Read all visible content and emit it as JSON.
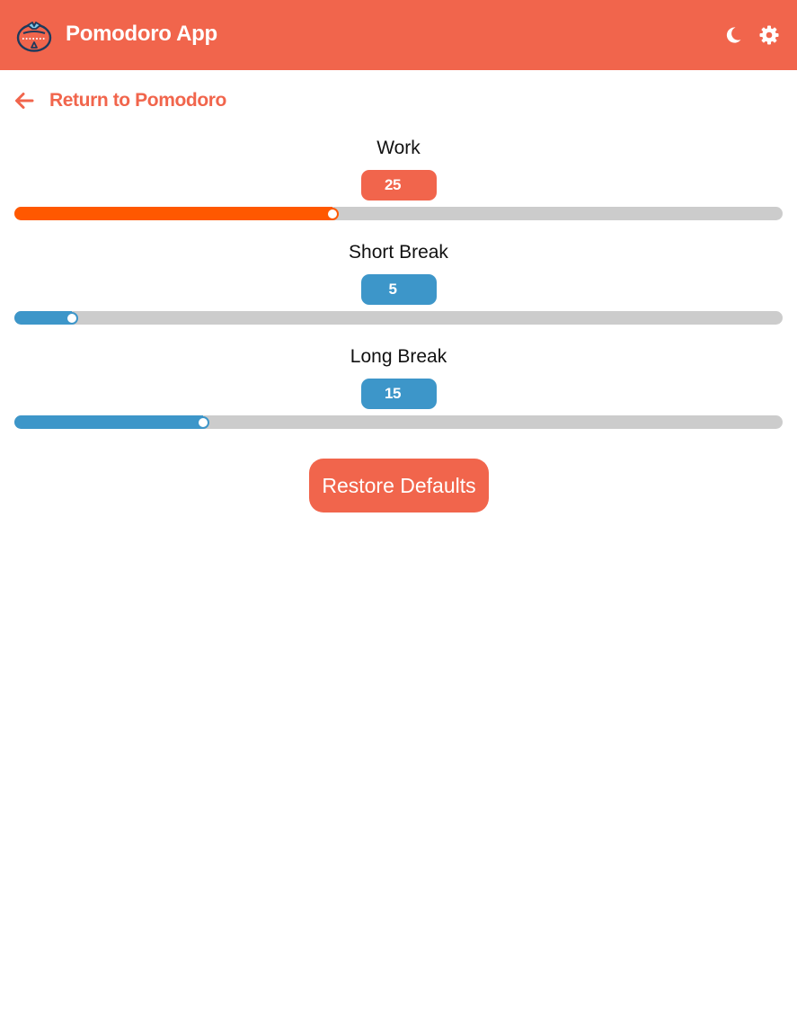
{
  "header": {
    "title": "Pomodoro App",
    "icons": {
      "logo": "tomato-timer-logo-icon",
      "theme": "moon-icon",
      "settings": "gear-icon"
    }
  },
  "nav": {
    "back_label": "Return to Pomodoro",
    "back_icon": "arrow-left-icon"
  },
  "settings": [
    {
      "label": "Work",
      "value": "25",
      "level": 0.414,
      "color": "#ff5800",
      "thumb_border": "#ff5800",
      "badge_color": "#f1654c"
    },
    {
      "label": "Short Break",
      "value": "5",
      "level": 0.075,
      "color": "#3d96c9",
      "thumb_border": "#3d96c9",
      "badge_color": "#3d96c9"
    },
    {
      "label": "Long Break",
      "value": "15",
      "level": 0.246,
      "color": "#3d96c9",
      "thumb_border": "#3d96c9",
      "badge_color": "#3d96c9"
    }
  ],
  "actions": {
    "restore_label": "Restore Defaults"
  },
  "colors": {
    "brand": "#f1654c",
    "track": "#cccccc"
  }
}
